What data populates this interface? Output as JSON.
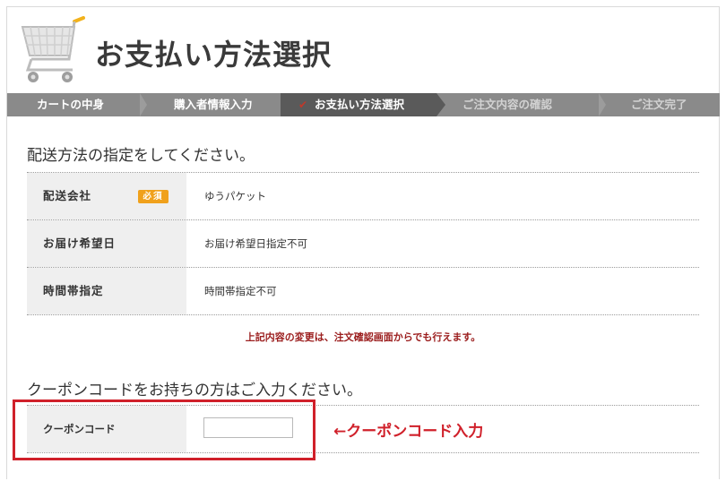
{
  "header": {
    "title": "お支払い方法選択",
    "cart_icon": "shopping-cart-icon"
  },
  "steps": [
    {
      "label": "カートの中身",
      "state": "done"
    },
    {
      "label": "購入者情報入力",
      "state": "done"
    },
    {
      "label": "お支払い方法選択",
      "state": "current",
      "icon": "check-icon"
    },
    {
      "label": "ご注文内容の確認",
      "state": "upcoming"
    },
    {
      "label": "ご注文完了",
      "state": "upcoming"
    }
  ],
  "delivery": {
    "heading": "配送方法の指定をしてください。",
    "rows": [
      {
        "label": "配送会社",
        "badge": "必須",
        "value": "ゆうパケット"
      },
      {
        "label": "お届け希望日",
        "value": "お届け希望日指定不可"
      },
      {
        "label": "時間帯指定",
        "value": "時間帯指定不可"
      }
    ],
    "notice": "上記内容の変更は、注文確認画面からでも行えます。"
  },
  "coupon": {
    "heading": "クーポンコードをお持ちの方はご入力ください。",
    "label": "クーポンコード",
    "input_value": "",
    "annotation": "←クーポンコード入力"
  },
  "colors": {
    "step_bar": "#8a8a8a",
    "step_active": "#5a5a5a",
    "badge": "#f0a11c",
    "highlight": "#d0202a",
    "notice": "#9b1d1d"
  }
}
